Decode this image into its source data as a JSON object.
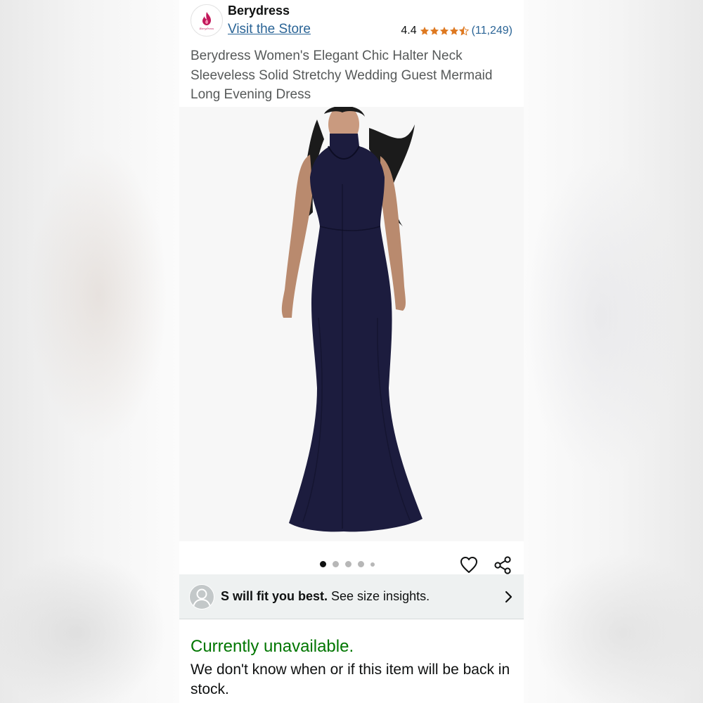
{
  "store": {
    "name": "Berydress",
    "visit_label": "Visit the Store",
    "rating": "4.4",
    "rating_count": "(11,249)",
    "stars_filled": 4.4,
    "logo_icon": "berydress-flame-logo"
  },
  "product": {
    "title": "Berydress Women's Elegant Chic Halter Neck Sleeveless Solid Stretchy Wedding Guest Mermaid Long Evening Dress",
    "image_description_icon": "product-photo"
  },
  "carousel": {
    "dots": 5,
    "active_index": 0
  },
  "actions": {
    "favorite_icon": "heart-icon",
    "share_icon": "share-icon"
  },
  "fit": {
    "bold": "S will fit you best.",
    "rest": " See size insights."
  },
  "availability": {
    "status": "Currently unavailable.",
    "message": "We don't know when or if this item will be back in stock."
  },
  "colors": {
    "link": "#2a6496",
    "star": "#de7921",
    "available_green": "#007600",
    "dress": "#1c1c3e"
  }
}
